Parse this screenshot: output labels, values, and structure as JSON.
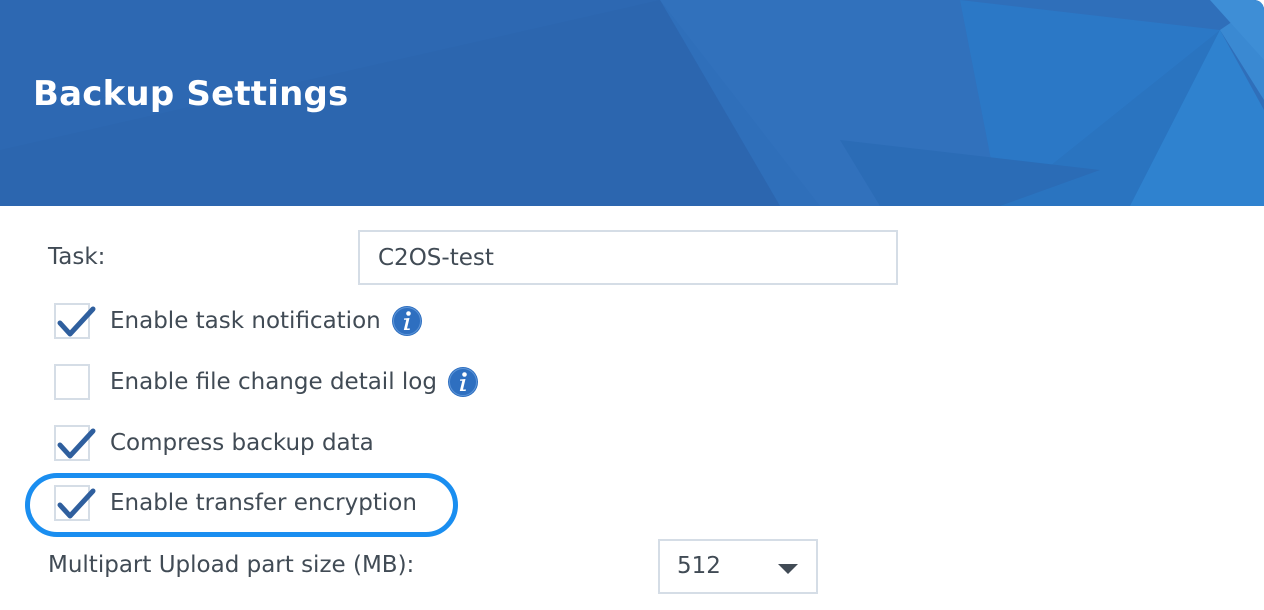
{
  "header": {
    "title": "Backup Settings"
  },
  "task": {
    "label": "Task:",
    "value": "C2OS-test"
  },
  "options": [
    {
      "label": "Enable task notification",
      "checked": true,
      "info_icon": "info-icon"
    },
    {
      "label": "Enable file change detail log",
      "checked": false,
      "info_icon": "info-icon"
    },
    {
      "label": "Compress backup data",
      "checked": true
    },
    {
      "label": "Enable transfer encryption",
      "checked": true,
      "highlighted": true
    }
  ],
  "multipart": {
    "label": "Multipart Upload part size (MB):",
    "value": "512",
    "icon": "chevron-down-icon"
  },
  "colors": {
    "header_bg": "#2d68b2",
    "highlight": "#1a8ef0",
    "check": "#2f5f9e",
    "info": "#2e6fc0"
  }
}
